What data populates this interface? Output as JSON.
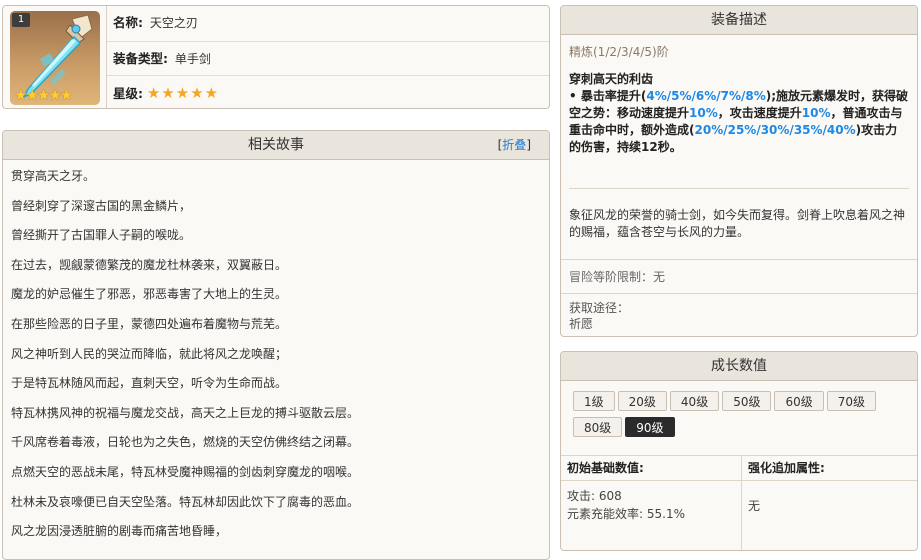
{
  "weapon": {
    "rarity_badge": "1",
    "name_label": "名称:",
    "name": "天空之刃",
    "type_label": "装备类型:",
    "type": "单手剑",
    "rarity_label": "星级:",
    "stars": 5,
    "star_glyph": "★"
  },
  "story": {
    "title": "相关故事",
    "toggle_prefix": "[",
    "toggle": "折叠",
    "toggle_suffix": "]",
    "lines": [
      "贯穿高天之牙。",
      "曾经刺穿了深邃古国的黑金鳞片，",
      "曾经撕开了古国罪人子嗣的喉咙。",
      "在过去，觊觎蒙德繁茂的魔龙杜林袭来，双翼蔽日。",
      "魔龙的妒忌催生了邪恶，邪恶毒害了大地上的生灵。",
      "在那些险恶的日子里，蒙德四处遍布着魔物与荒芜。",
      "风之神听到人民的哭泣而降临，就此将风之龙唤醒；",
      "于是特瓦林随风而起，直刺天空，听令为生命而战。",
      "特瓦林携风神的祝福与魔龙交战，高天之上巨龙的搏斗驱散云层。",
      "千风席卷着毒液，日轮也为之失色，燃烧的天空仿佛终结之闭幕。",
      "点燃天空的恶战未尾，特瓦林受魔神赐福的剑齿刺穿魔龙的咽喉。",
      "杜林未及哀嚎便已自天空坠落。特瓦林却因此饮下了腐毒的恶血。",
      "风之龙因浸透脏腑的剧毒而痛苦地昏睡，"
    ]
  },
  "description": {
    "title": "装备描述",
    "refinement": "精炼(1/2/3/4/5)阶",
    "passive_name": "穿刺高天的利齿",
    "passive": {
      "t1": "• 暴击率提升(",
      "h1": "4%/5%/6%/7%/8%",
      "t2": ");施放元素爆发时，获得破空之势：移动速度提升",
      "h2": "10%",
      "t3": "，攻击速度提升",
      "h3": "10%",
      "t4": "，普通攻击与重击命中时，额外造成(",
      "h4": "20%/25%/30%/35%/40%",
      "t5": ")攻击力的伤害，持续12秒。"
    },
    "lore": "象征风龙的荣誉的骑士剑，如今失而复得。剑脊上吹息着风之神的赐福，蕴含苍空与长风的力量。",
    "level_limit": "冒险等阶限制：无",
    "source_label": "获取途径：",
    "source": "祈愿"
  },
  "growth": {
    "title": "成长数值",
    "levels": [
      "1级",
      "20级",
      "40级",
      "50级",
      "60级",
      "70级",
      "80级",
      "90级"
    ],
    "active_level": "90级",
    "base_header": "初始基础数值:",
    "attack": "攻击: 608",
    "energy_recharge": "元素充能效率: 55.1%",
    "bonus_header": "强化追加属性:",
    "bonus": "无"
  }
}
